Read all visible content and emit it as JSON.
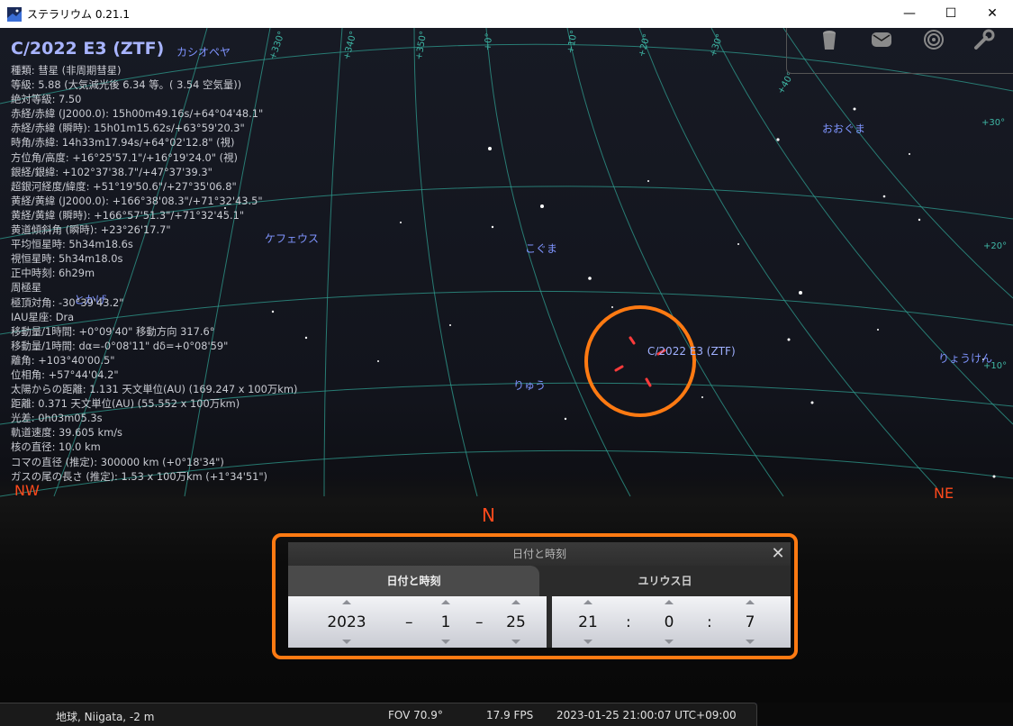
{
  "window": {
    "title": "ステラリウム 0.21.1",
    "minimize": "—",
    "maximize": "☐",
    "close": "✕"
  },
  "info_panel": {
    "title": "C/2022 E3 (ZTF)",
    "lines": [
      "種類: 彗星 (非周期彗星)",
      "等級: 5.88 (大気減光後 6.34 等。( 3.54 空気量))",
      "絶対等級: 7.50",
      "赤経/赤緯 (J2000.0): 15h00m49.16s/+64°04'48.1\"",
      "赤経/赤緯 (瞬時): 15h01m15.62s/+63°59'20.3\"",
      "時角/赤緯: 14h33m17.94s/+64°02'12.8\" (視)",
      "方位角/高度: +16°25'57.1\"/+16°19'24.0\" (視)",
      "銀経/銀緯: +102°37'38.7\"/+47°37'39.3\"",
      "超銀河経度/緯度: +51°19'50.6\"/+27°35'06.8\"",
      "黄経/黄緯 (J2000.0): +166°38'08.3\"/+71°32'43.5\"",
      "黄経/黄緯 (瞬時): +166°57'51.3\"/+71°32'45.1\"",
      "黄道傾斜角 (瞬時): +23°26'17.7\"",
      "平均恒星時: 5h34m18.6s",
      "視恒星時: 5h34m18.0s",
      "正中時刻: 6h29m",
      "周極星",
      "極頂対角: -30°39'43.2\"",
      "IAU星座: Dra",
      "移動量/1時間: +0°09'40\" 移動方向 317.6°",
      "移動量/1時間: dα=-0°08'11\" dδ=+0°08'59\"",
      "離角: +103°40'00.5\"",
      "位相角: +57°44'04.2\"",
      "太陽からの距離: 1.131 天文単位(AU) (169.247 x 100万km)",
      "距離: 0.371 天文単位(AU) (55.552 x 100万km)",
      "光差: 0h03m05.3s",
      "軌道速度: 39.605 km/s",
      "核の直径: 10.0 km",
      "コマの直径 (推定): 300000 km (+0°18'34\")",
      "ガスの尾の長さ (推定): 1.53 x 100万km (+1°34'51\")"
    ]
  },
  "sky_labels": {
    "constellations": [
      "カシオペヤ",
      "おおぐま",
      "ケフェウス",
      "こぐま",
      "とかげ",
      "りゅう",
      "りょうけん"
    ],
    "comet_label": "C/2022 E3 (ZTF)",
    "grid": [
      "+350°",
      "+340°",
      "+330°",
      "+0°",
      "+10°",
      "+20°",
      "+30°",
      "+40°",
      "+30°",
      "+20°",
      "+10°"
    ],
    "compass": {
      "nw": "NW",
      "n": "N",
      "ne": "NE"
    }
  },
  "toolbar": {
    "icons": [
      "trash-icon",
      "chat-icon",
      "target-icon",
      "wrench-icon"
    ]
  },
  "dialog": {
    "title": "日付と時刻",
    "close": "✕",
    "tab_datetime": "日付と時刻",
    "tab_julian": "ユリウス日",
    "year": "2023",
    "month": "1",
    "day": "25",
    "hour": "21",
    "minute": "0",
    "second": "7",
    "date_sep": "–",
    "time_sep": ":"
  },
  "statusbar": {
    "location": "地球, Niigata, -2 m",
    "fov": "FOV 70.9°",
    "fps": "17.9 FPS",
    "datetime": "2023-01-25 21:00:07 UTC+09:00"
  },
  "colors": {
    "highlight": "#ff7a12",
    "grid": "#3fb7a6",
    "constellation": "#7f94ff",
    "compass": "#ff4a1c",
    "comet_marker": "#ff3b3b"
  }
}
